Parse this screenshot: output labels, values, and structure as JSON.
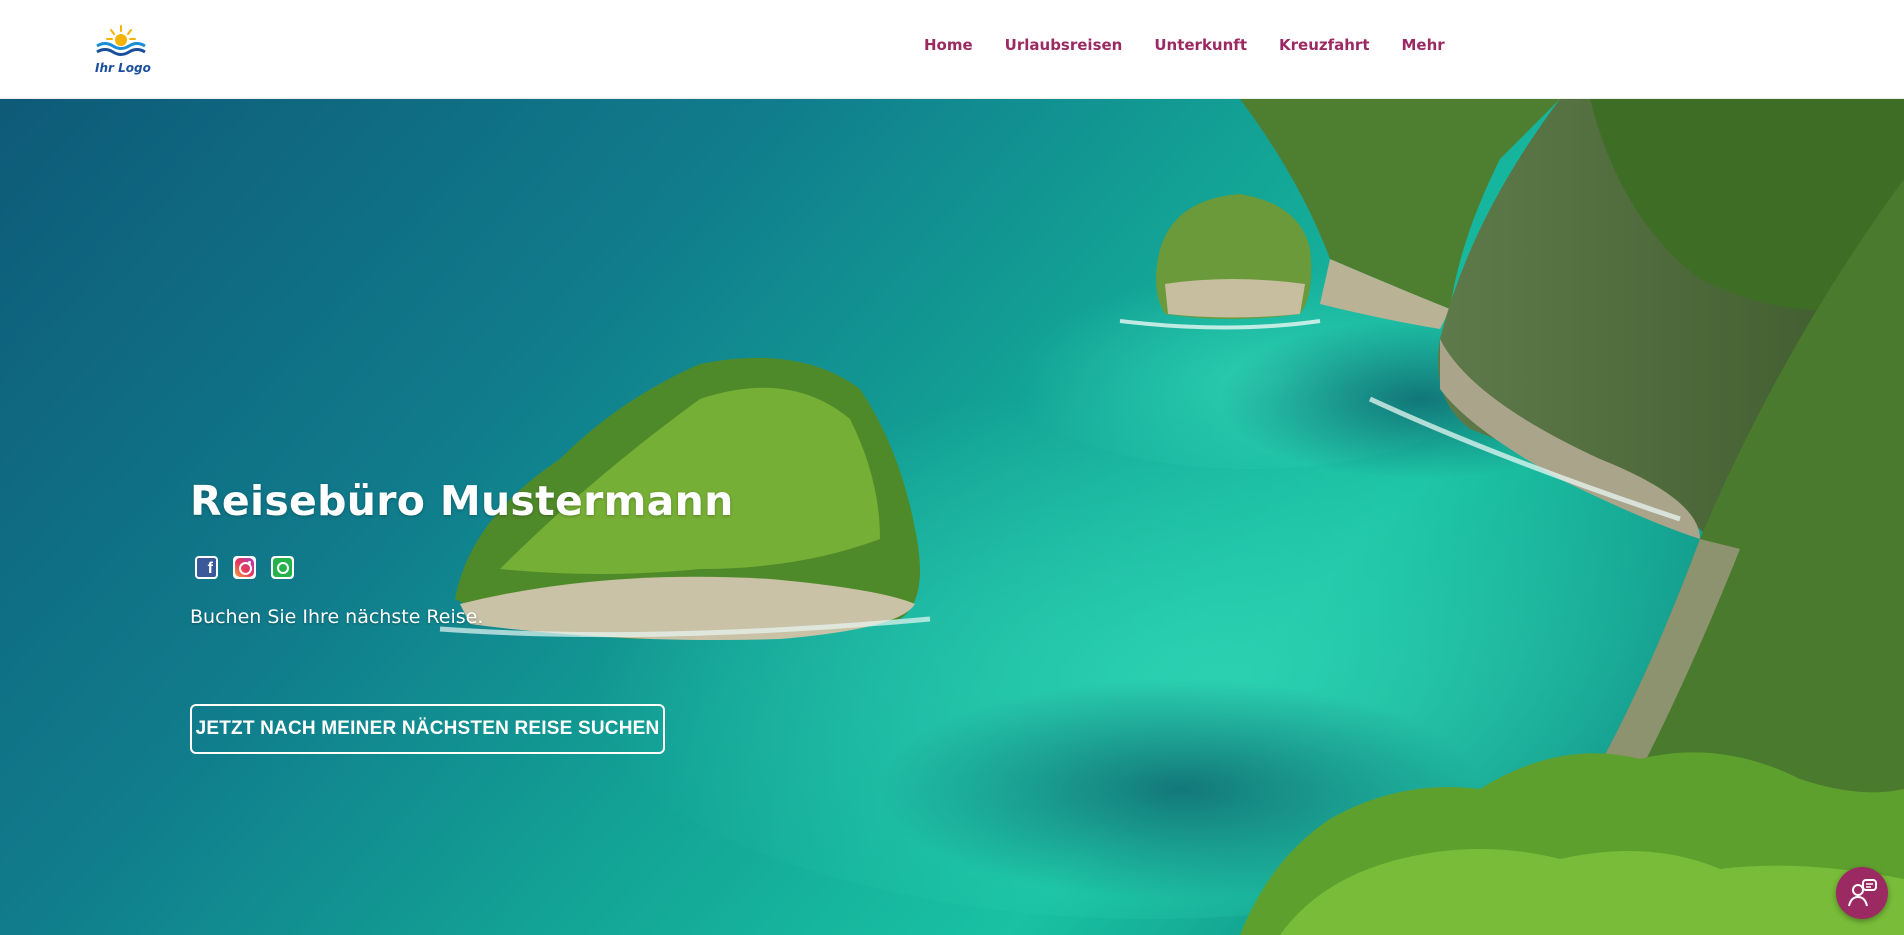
{
  "header": {
    "logo_text": "Ihr Logo",
    "nav": [
      {
        "label": "Home"
      },
      {
        "label": "Urlaubsreisen"
      },
      {
        "label": "Unterkunft"
      },
      {
        "label": "Kreuzfahrt"
      },
      {
        "label": "Mehr"
      }
    ]
  },
  "hero": {
    "title": "Reisebüro Mustermann",
    "socials": [
      "facebook-icon",
      "instagram-icon",
      "whatsapp-icon"
    ],
    "subtitle": "Buchen Sie Ihre nächste Reise.",
    "cta_label": "JETZT NACH MEINER NÄCHSTEN REISE SUCHEN"
  },
  "chat": {
    "icon": "chat-icon"
  },
  "colors": {
    "accent": "#9c2a62",
    "logo_blue": "#1a4f9c",
    "logo_sun": "#f4b400"
  }
}
